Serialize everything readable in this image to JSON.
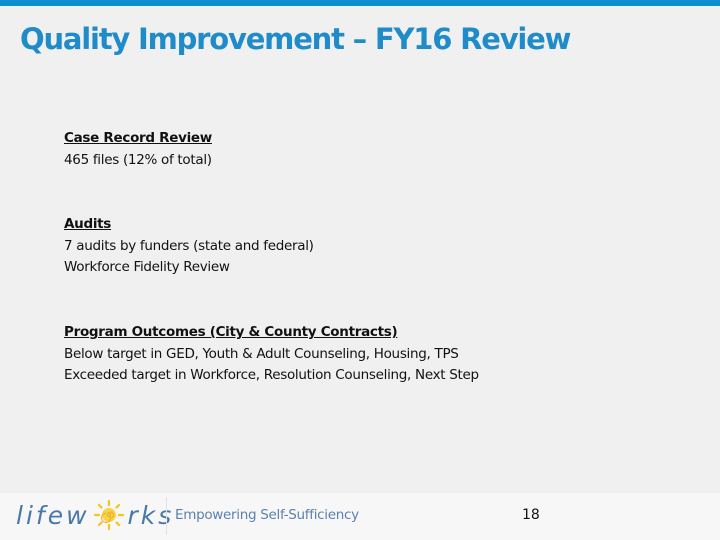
{
  "slide": {
    "title": "Quality Improvement – FY16 Review",
    "accent_color": "#0b8fcf",
    "title_color": "#1f8cc9",
    "sections": [
      {
        "heading": "Case Record Review",
        "lines": [
          "465 files (12% of total)"
        ]
      },
      {
        "heading": "Audits",
        "lines": [
          "7 audits by funders (state and federal)",
          "Workforce Fidelity Review"
        ]
      },
      {
        "heading": "Program Outcomes (City & County Contracts)",
        "lines": [
          "Below target in GED, Youth & Adult Counseling, Housing, TPS",
          "Exceeded target in Workforce, Resolution Counseling, Next Step"
        ]
      }
    ]
  },
  "footer": {
    "logo_text_left": "lifew",
    "logo_text_right": "rks",
    "logo_icon": "sun-icon",
    "tagline": "Empowering Self-Sufficiency",
    "page_number": "18"
  }
}
